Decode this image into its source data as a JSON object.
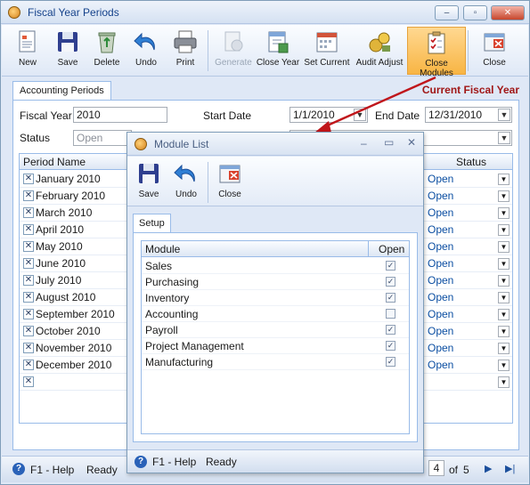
{
  "window": {
    "title": "Fiscal Year Periods",
    "minimize": "–",
    "maximize": "▫",
    "close": "✕"
  },
  "toolbar": {
    "new": "New",
    "save": "Save",
    "delete": "Delete",
    "undo": "Undo",
    "print": "Print",
    "generate": "Generate",
    "close_year": "Close Year",
    "set_current": "Set Current",
    "audit_adjust": "Audit Adjust",
    "close_modules": "Close Modules",
    "close": "Close"
  },
  "tab": {
    "label": "Accounting Periods"
  },
  "current_fiscal_year_label": "Current Fiscal Year",
  "form": {
    "fiscal_year_label": "Fiscal Year",
    "fiscal_year_value": "2010",
    "start_date_label": "Start Date",
    "start_date_value": "1/1/2010",
    "end_date_label": "End Date",
    "end_date_value": "12/31/2010",
    "status_label": "Status",
    "status_value": "Open"
  },
  "grid": {
    "col_period": "Period Name",
    "col_status": "Status",
    "rows": [
      {
        "name": "January 2010",
        "status": "Open"
      },
      {
        "name": "February 2010",
        "status": "Open"
      },
      {
        "name": "March 2010",
        "status": "Open"
      },
      {
        "name": "April 2010",
        "status": "Open"
      },
      {
        "name": "May 2010",
        "status": "Open"
      },
      {
        "name": "June 2010",
        "status": "Open"
      },
      {
        "name": "July 2010",
        "status": "Open"
      },
      {
        "name": "August 2010",
        "status": "Open"
      },
      {
        "name": "September 2010",
        "status": "Open"
      },
      {
        "name": "October 2010",
        "status": "Open"
      },
      {
        "name": "November 2010",
        "status": "Open"
      },
      {
        "name": "December 2010",
        "status": "Open"
      }
    ]
  },
  "statusbar": {
    "help": "F1 - Help",
    "state": "Ready",
    "page_current": "4",
    "page_of": "of",
    "page_total": "5"
  },
  "dialog": {
    "title": "Module List",
    "save": "Save",
    "undo": "Undo",
    "close": "Close",
    "tab": "Setup",
    "col_module": "Module",
    "col_open": "Open",
    "modules": [
      {
        "name": "Sales",
        "open": true
      },
      {
        "name": "Purchasing",
        "open": true
      },
      {
        "name": "Inventory",
        "open": true
      },
      {
        "name": "Accounting",
        "open": false
      },
      {
        "name": "Payroll",
        "open": true
      },
      {
        "name": "Project Management",
        "open": true
      },
      {
        "name": "Manufacturing",
        "open": true
      }
    ],
    "help": "F1 - Help",
    "state": "Ready"
  },
  "colors": {
    "accent": "#15428b",
    "highlight": "#f8b544",
    "current_year": "#a01717",
    "arrow": "#c0161b"
  }
}
